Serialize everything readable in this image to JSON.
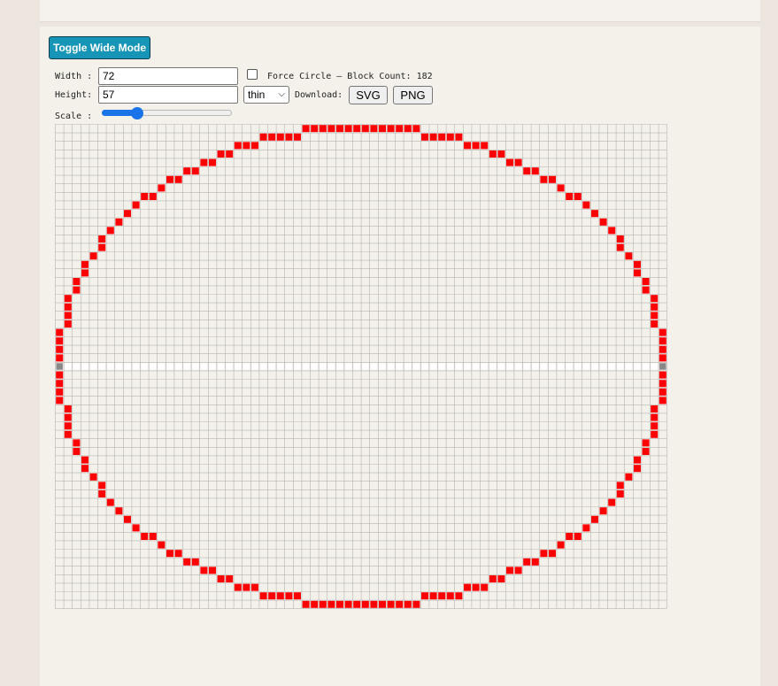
{
  "toolbar": {
    "toggle_label": "Toggle Wide Mode",
    "width_label": "Width :",
    "width_value": "72",
    "height_label": "Height:",
    "height_value": "57",
    "force_circle_label": "Force Circle — Block Count: 182",
    "force_circle_checked": false,
    "thickness_selected": "thin",
    "download_label": "Download:",
    "svg_label": "SVG",
    "png_label": "PNG",
    "scale_label": "Scale :",
    "scale_fraction": 0.25
  },
  "grid": {
    "cols": 72,
    "rows": 57,
    "fill_color": "#ff0000",
    "midline_color": "#888888",
    "grid_color": "#b5b5b5"
  }
}
